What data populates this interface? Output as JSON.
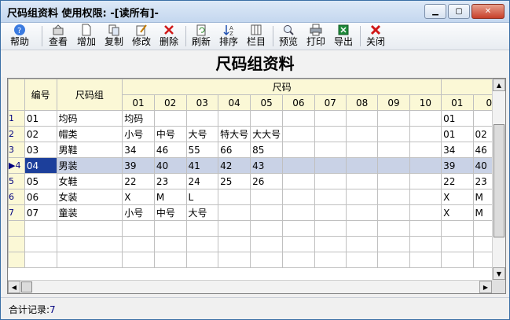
{
  "window": {
    "title": "尺码组资料  使用权限: -[读所有]-",
    "controls": {
      "minimize": "▁",
      "maximize": "▢",
      "close": "✕"
    }
  },
  "toolbar": {
    "buttons": [
      {
        "id": "help",
        "label": "帮助",
        "icon": "help-icon"
      },
      {
        "id": "view",
        "label": "查看",
        "icon": "view-icon"
      },
      {
        "id": "add",
        "label": "增加",
        "icon": "new-page-icon"
      },
      {
        "id": "copy",
        "label": "复制",
        "icon": "copy-icon"
      },
      {
        "id": "edit",
        "label": "修改",
        "icon": "edit-icon"
      },
      {
        "id": "delete",
        "label": "删除",
        "icon": "delete-x-icon"
      },
      {
        "id": "refresh",
        "label": "刷新",
        "icon": "refresh-icon"
      },
      {
        "id": "sort",
        "label": "排序",
        "icon": "sort-icon"
      },
      {
        "id": "columns",
        "label": "栏目",
        "icon": "columns-icon"
      },
      {
        "id": "preview",
        "label": "预览",
        "icon": "magnifier-icon"
      },
      {
        "id": "print",
        "label": "打印",
        "icon": "printer-icon"
      },
      {
        "id": "export",
        "label": "导出",
        "icon": "excel-icon"
      },
      {
        "id": "close",
        "label": "关闭",
        "icon": "close-x-icon"
      }
    ]
  },
  "page": {
    "heading": "尺码组资料"
  },
  "grid": {
    "headers": {
      "code": "编号",
      "group": "尺码组",
      "sizes": "尺码",
      "size_cols": [
        "01",
        "02",
        "03",
        "04",
        "05",
        "06",
        "07",
        "08",
        "09",
        "10"
      ],
      "extra_cols": [
        "01",
        "0"
      ]
    },
    "rows": [
      {
        "num": "1",
        "code": "01",
        "name": "均码",
        "sizes": [
          "均码",
          "",
          "",
          "",
          "",
          "",
          "",
          "",
          "",
          ""
        ],
        "extra": [
          "01",
          ""
        ]
      },
      {
        "num": "2",
        "code": "02",
        "name": "帽类",
        "sizes": [
          "小号",
          "中号",
          "大号",
          "特大号",
          "大大号",
          "",
          "",
          "",
          "",
          ""
        ],
        "extra": [
          "01",
          "02"
        ]
      },
      {
        "num": "3",
        "code": "03",
        "name": "男鞋",
        "sizes": [
          "34",
          "46",
          "55",
          "66",
          "85",
          "",
          "",
          "",
          "",
          ""
        ],
        "extra": [
          "34",
          "46"
        ]
      },
      {
        "num": "4",
        "code": "04",
        "name": "男装",
        "sizes": [
          "39",
          "40",
          "41",
          "42",
          "43",
          "",
          "",
          "",
          "",
          ""
        ],
        "extra": [
          "39",
          "40"
        ]
      },
      {
        "num": "5",
        "code": "05",
        "name": "女鞋",
        "sizes": [
          "22",
          "23",
          "24",
          "25",
          "26",
          "",
          "",
          "",
          "",
          ""
        ],
        "extra": [
          "22",
          "23"
        ]
      },
      {
        "num": "6",
        "code": "06",
        "name": "女装",
        "sizes": [
          "X",
          "M",
          "L",
          "",
          "",
          "",
          "",
          "",
          "",
          ""
        ],
        "extra": [
          "X",
          "M"
        ]
      },
      {
        "num": "7",
        "code": "07",
        "name": "童装",
        "sizes": [
          "小号",
          "中号",
          "大号",
          "",
          "",
          "",
          "",
          "",
          "",
          ""
        ],
        "extra": [
          "X",
          "M"
        ]
      }
    ],
    "selected_row": 4,
    "row_indicator": "▶",
    "scroll_up": "▲",
    "scroll_down": "▼",
    "scroll_left": "◀",
    "scroll_right": "▶"
  },
  "status": {
    "label": "合计记录:",
    "count": "7"
  }
}
